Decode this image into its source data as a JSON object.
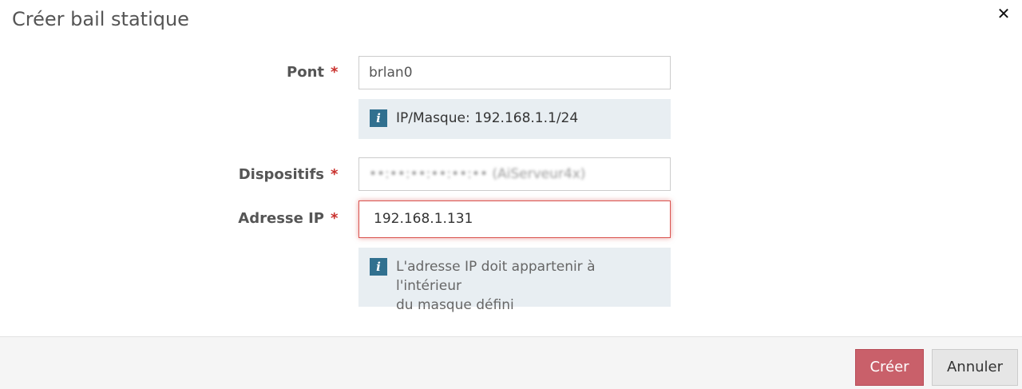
{
  "dialog": {
    "title": "Créer bail statique",
    "close_glyph": "✕"
  },
  "form": {
    "required_mark": "*",
    "bridge": {
      "label": "Pont",
      "value": "brlan0"
    },
    "bridge_info": {
      "icon": "info-icon",
      "icon_glyph": "i",
      "text": "IP/Masque: 192.168.1.1/24"
    },
    "devices": {
      "label": "Dispositifs",
      "value": "••:••:••:••:••:•• (AiServeur4x)"
    },
    "ip_address": {
      "label": "Adresse IP",
      "value": "192.168.1.131",
      "state": "error"
    },
    "ip_info": {
      "icon": "info-icon",
      "icon_glyph": "i",
      "text_line1": "L'adresse IP doit appartenir à l'intérieur",
      "text_line2": "du masque défini"
    }
  },
  "footer": {
    "create_label": "Créer",
    "cancel_label": "Annuler"
  },
  "colors": {
    "required": "#c9302c",
    "info_icon_bg": "#31708f",
    "info_box_bg": "#e8eef2",
    "primary_button": "#c9606a",
    "error_border": "#d9534f"
  }
}
